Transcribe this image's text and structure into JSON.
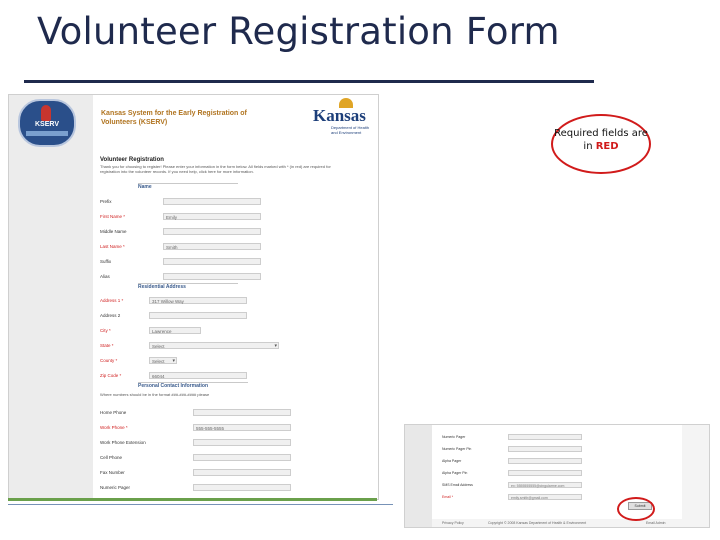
{
  "slide": {
    "title": "Volunteer Registration Form"
  },
  "callout": {
    "line1": "Required fields are",
    "line2_prefix": "in ",
    "line2_red": "RED"
  },
  "colors": {
    "title": "#1f2a4d",
    "required": "#d11b1b",
    "section": "#3a5b8c"
  },
  "app": {
    "logo_text": "KSERV",
    "header_title": "Kansas System for the Early Registration of Volunteers (KSERV)",
    "kansas_logo_text": "Kansas",
    "kansas_logo_dept": "Department of Health and Environment",
    "form_title": "Volunteer Registration",
    "instructions": "Thank you for choosing to register! Please enter your information in the form below. All fields marked with * (in red) are required for registration into the volunteer records. If you need help, click here for more information."
  },
  "sections": {
    "name": "Name",
    "address": "Residential Address",
    "contact": "Personal Contact Information"
  },
  "name_fields": [
    {
      "label": "Prefix",
      "value": "",
      "required": false
    },
    {
      "label": "First Name *",
      "value": "Emily",
      "required": true
    },
    {
      "label": "Middle Name",
      "value": "",
      "required": false
    },
    {
      "label": "Last Name *",
      "value": "Smith",
      "required": true
    },
    {
      "label": "Suffix",
      "value": "",
      "required": false
    },
    {
      "label": "Alias",
      "value": "",
      "required": false
    }
  ],
  "address_fields": [
    {
      "label": "Address 1 *",
      "value": "317 Willow Way",
      "required": true
    },
    {
      "label": "Address 2",
      "value": "",
      "required": false
    },
    {
      "label": "City *",
      "value": "Lawrence",
      "required": true
    },
    {
      "label": "State *",
      "value": "Select",
      "required": true
    },
    {
      "label": "County *",
      "value": "Select",
      "required": true
    },
    {
      "label": "Zip Code *",
      "value": "66044",
      "required": true
    }
  ],
  "contact": {
    "note": "Where numbers should be in the format ###-###-#### please",
    "fields": [
      {
        "label": "Home Phone",
        "value": "",
        "required": false
      },
      {
        "label": "Work Phone *",
        "value": "555-555-5555",
        "required": true
      },
      {
        "label": "Work Phone Extension",
        "value": "",
        "required": false
      },
      {
        "label": "Cell Phone",
        "value": "",
        "required": false
      },
      {
        "label": "Fax Number",
        "value": "",
        "required": false
      },
      {
        "label": "Numeric Pager",
        "value": "",
        "required": false
      }
    ]
  },
  "inset": {
    "fields": [
      {
        "label": "Numeric Pager",
        "value": "",
        "required": false
      },
      {
        "label": "Numeric Pager Pin",
        "value": "",
        "required": false
      },
      {
        "label": "Alpha Pager",
        "value": "",
        "required": false
      },
      {
        "label": "Alpha Pager Pin",
        "value": "",
        "required": false
      },
      {
        "label": "SMS Email Address",
        "value": "ex: 5555555555@cingularme.com",
        "required": false
      },
      {
        "label": "Email *",
        "value": "emily.smith@gmail.com",
        "required": true
      }
    ],
    "submit_label": "Submit",
    "footer_left": "Privacy Policy",
    "footer_center": "Copyright © 2008 Kansas Department of Health & Environment",
    "footer_right": "Email Admin"
  }
}
